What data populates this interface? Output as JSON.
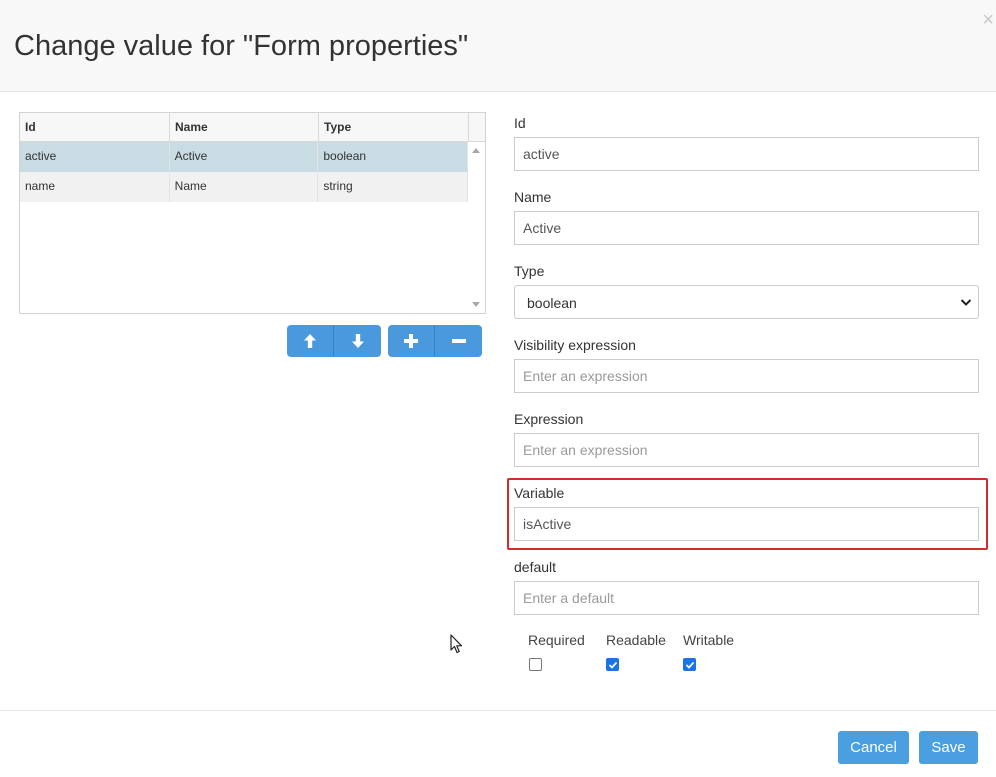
{
  "dialog": {
    "title": "Change value for \"Form properties\"",
    "close_glyph": "×"
  },
  "grid": {
    "columns": [
      "Id",
      "Name",
      "Type"
    ],
    "rows": [
      {
        "id": "active",
        "name": "Active",
        "type": "boolean",
        "selected": true
      },
      {
        "id": "name",
        "name": "Name",
        "type": "string",
        "selected": false
      }
    ]
  },
  "grid_buttons": [
    {
      "icon": "arrow-up-icon"
    },
    {
      "icon": "arrow-down-icon"
    },
    {
      "icon": "plus-icon"
    },
    {
      "icon": "minus-icon"
    }
  ],
  "form": {
    "id": {
      "label": "Id",
      "value": "active"
    },
    "name": {
      "label": "Name",
      "value": "Active"
    },
    "type": {
      "label": "Type",
      "value": "boolean"
    },
    "visibility": {
      "label": "Visibility expression",
      "value": "",
      "placeholder": "Enter an expression"
    },
    "expression": {
      "label": "Expression",
      "value": "",
      "placeholder": "Enter an expression"
    },
    "variable": {
      "label": "Variable",
      "value": "isActive"
    },
    "default": {
      "label": "default",
      "value": "",
      "placeholder": "Enter a default"
    },
    "checkboxes": [
      {
        "label": "Required",
        "checked": false
      },
      {
        "label": "Readable",
        "checked": true
      },
      {
        "label": "Writable",
        "checked": true
      }
    ]
  },
  "footer": {
    "cancel_label": "Cancel",
    "save_label": "Save"
  },
  "colors": {
    "accent": "#4a99dd",
    "highlight": "#d42b2b",
    "selected_row": "#c9dbe3"
  }
}
